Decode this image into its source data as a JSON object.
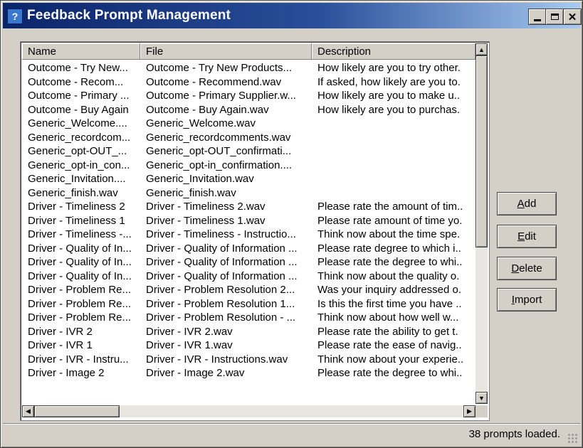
{
  "window": {
    "title": "Feedback Prompt Management",
    "icon": "app-icon",
    "controls": [
      "minimize-icon",
      "maximize-icon",
      "close-icon"
    ]
  },
  "list": {
    "columns": [
      "Name",
      "File",
      "Description"
    ],
    "rows": [
      [
        "Outcome - Try New...",
        "Outcome - Try New Products...",
        "How likely are you to try other."
      ],
      [
        "Outcome - Recom...",
        "Outcome - Recommend.wav",
        "If asked, how likely are you to."
      ],
      [
        "Outcome - Primary ...",
        "Outcome - Primary Supplier.w...",
        "How likely are you to make u.."
      ],
      [
        "Outcome - Buy Again",
        "Outcome - Buy Again.wav",
        "How likely are you to purchas."
      ],
      [
        "Generic_Welcome....",
        "Generic_Welcome.wav",
        ""
      ],
      [
        "Generic_recordcom...",
        "Generic_recordcomments.wav",
        ""
      ],
      [
        "Generic_opt-OUT_...",
        "Generic_opt-OUT_confirmati...",
        ""
      ],
      [
        "Generic_opt-in_con...",
        "Generic_opt-in_confirmation....",
        ""
      ],
      [
        "Generic_Invitation....",
        "Generic_Invitation.wav",
        ""
      ],
      [
        "Generic_finish.wav",
        "Generic_finish.wav",
        ""
      ],
      [
        "Driver - Timeliness 2",
        "Driver - Timeliness 2.wav",
        "Please rate the amount of tim.."
      ],
      [
        "Driver - Timeliness 1",
        "Driver - Timeliness 1.wav",
        "Please rate amount of time yo."
      ],
      [
        "Driver - Timeliness -...",
        "Driver - Timeliness - Instructio...",
        "Think now about the time spe."
      ],
      [
        "Driver - Quality of In...",
        "Driver - Quality of Information ...",
        "Please rate degree to which i.."
      ],
      [
        "Driver - Quality of In...",
        "Driver - Quality of Information ...",
        "Please rate the degree to whi.."
      ],
      [
        "Driver - Quality of In...",
        "Driver - Quality of Information ...",
        "Think now about the quality o."
      ],
      [
        "Driver - Problem Re...",
        "Driver - Problem Resolution 2...",
        "Was your inquiry addressed o."
      ],
      [
        "Driver - Problem Re...",
        "Driver - Problem Resolution 1...",
        "Is this the first time you have .."
      ],
      [
        "Driver - Problem Re...",
        "Driver - Problem Resolution - ...",
        "Think now about how well w..."
      ],
      [
        "Driver - IVR 2",
        "Driver - IVR 2.wav",
        "Please rate the ability  to get t."
      ],
      [
        "Driver - IVR 1",
        "Driver - IVR 1.wav",
        "Please rate the ease of navig.."
      ],
      [
        "Driver - IVR - Instru...",
        "Driver - IVR - Instructions.wav",
        "Think now about your experie.."
      ],
      [
        "Driver - Image 2",
        "Driver - Image 2.wav",
        "Please rate the degree to whi.."
      ]
    ],
    "vertical_scroll_fraction": 0.0
  },
  "buttons": {
    "add": "Add",
    "edit": "Edit",
    "delete": "Delete",
    "import": "Import"
  },
  "status": {
    "text": "38 prompts loaded."
  }
}
